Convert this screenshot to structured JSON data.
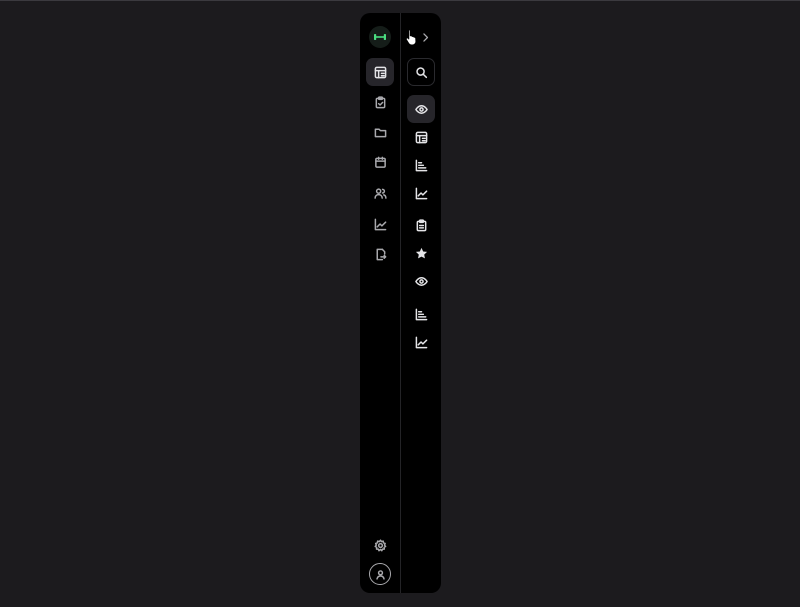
{
  "app": {
    "name": ""
  },
  "primary_nav": {
    "logo_icon": "dumbbell-icon",
    "items": [
      {
        "id": "dashboard",
        "icon": "calendar-grid-icon",
        "active": true
      },
      {
        "id": "tasks",
        "icon": "clipboard-check-icon",
        "active": false
      },
      {
        "id": "files",
        "icon": "folder-icon",
        "active": false
      },
      {
        "id": "calendar",
        "icon": "calendar-icon",
        "active": false
      },
      {
        "id": "people",
        "icon": "users-icon",
        "active": false
      },
      {
        "id": "analytics",
        "icon": "line-chart-icon",
        "active": false
      },
      {
        "id": "export",
        "icon": "file-export-icon",
        "active": false
      }
    ],
    "footer": [
      {
        "id": "settings",
        "icon": "gear-icon"
      },
      {
        "id": "profile",
        "icon": "user-circle-icon"
      }
    ]
  },
  "secondary_nav": {
    "expand_icon": "chevron-right-icon",
    "search_icon": "search-icon",
    "items": [
      {
        "id": "overview",
        "icon": "eye-icon",
        "active": true
      },
      {
        "id": "schedule",
        "icon": "calendar-grid-icon",
        "active": false
      },
      {
        "id": "stats",
        "icon": "bar-chart-horizontal-icon",
        "active": false
      },
      {
        "id": "trends",
        "icon": "line-chart-icon",
        "active": false
      },
      {
        "id": "reports",
        "icon": "clipboard-icon",
        "active": false
      },
      {
        "id": "favorites",
        "icon": "star-icon",
        "active": false
      },
      {
        "id": "watch",
        "icon": "eye-icon",
        "active": false
      },
      {
        "id": "ranking",
        "icon": "bar-chart-horizontal-icon",
        "active": false
      },
      {
        "id": "growth",
        "icon": "line-chart-icon",
        "active": false
      }
    ]
  },
  "colors": {
    "background": "#1c1b1e",
    "panel": "#000000",
    "accent": "#4ade80",
    "icon": "#a9a9ad",
    "icon_active": "#e4e4e7"
  }
}
